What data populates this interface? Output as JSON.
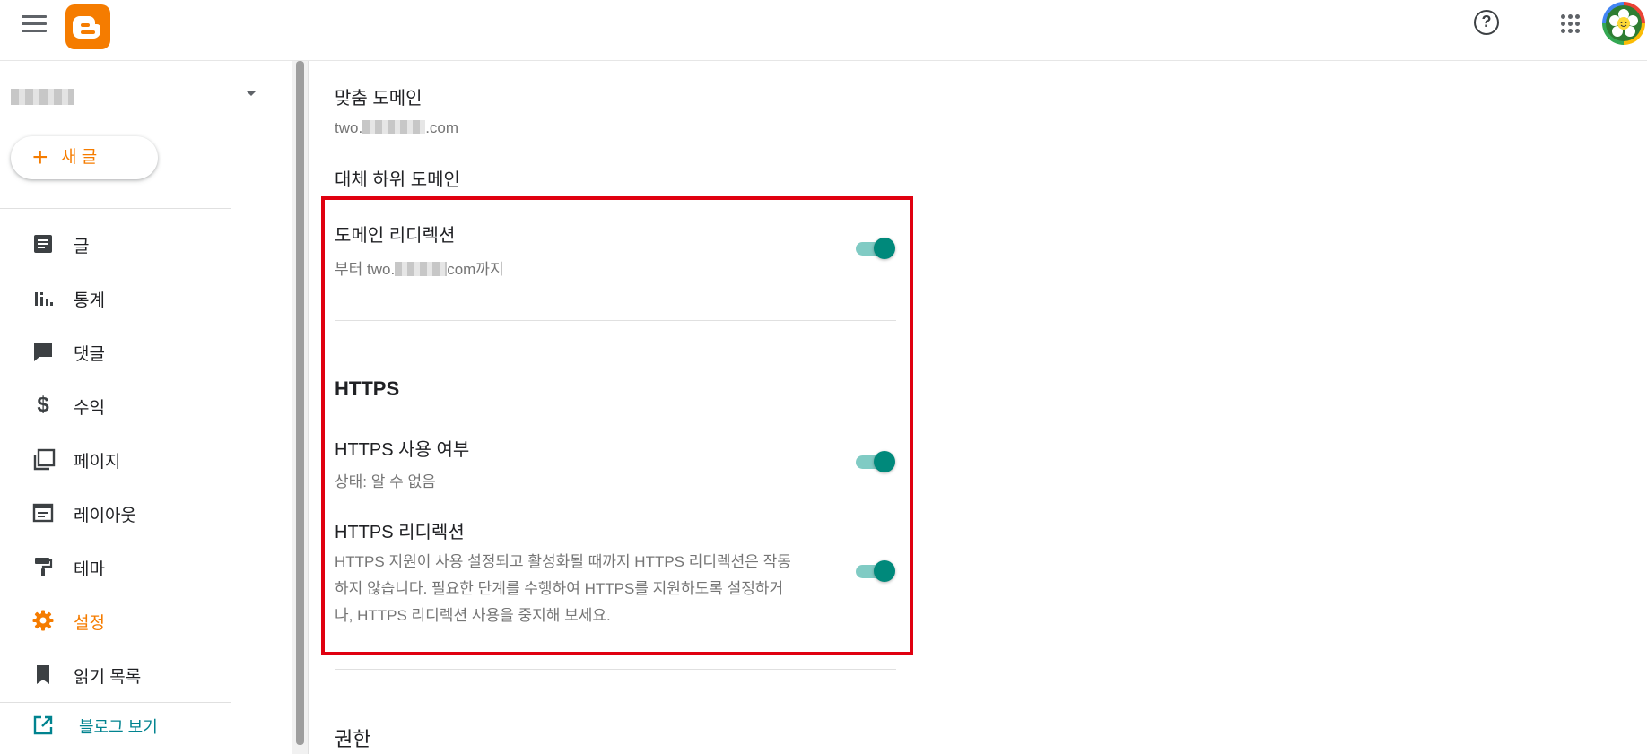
{
  "header": {
    "menu_icon": "hamburger-menu-icon",
    "logo_icon": "blogger-logo-icon",
    "help_icon": "help-circle-icon",
    "help_glyph": "?",
    "apps_icon": "apps-grid-icon",
    "avatar_icon": "user-avatar"
  },
  "sidebar": {
    "blog_selector_icon": "blog-dropdown-caret-icon",
    "new_post": {
      "plus": "+",
      "label": "새 글"
    },
    "items": [
      {
        "label": "글",
        "icon": "posts-icon"
      },
      {
        "label": "통계",
        "icon": "stats-icon"
      },
      {
        "label": "댓글",
        "icon": "comments-icon"
      },
      {
        "label": "수익",
        "icon": "earnings-dollar-icon"
      },
      {
        "label": "페이지",
        "icon": "pages-icon"
      },
      {
        "label": "레이아웃",
        "icon": "layout-icon"
      },
      {
        "label": "테마",
        "icon": "theme-paint-roller-icon"
      },
      {
        "label": "설정",
        "icon": "settings-gear-icon",
        "active": true
      },
      {
        "label": "읽기 목록",
        "icon": "reading-list-bookmark-icon"
      }
    ],
    "view_blog": {
      "label": "블로그 보기",
      "icon": "open-external-icon"
    }
  },
  "content": {
    "custom_domain": {
      "title": "맞춤 도메인",
      "value_prefix": "two.",
      "value_suffix": ".com"
    },
    "fallback_subdomain": {
      "title": "대체 하위 도메인"
    },
    "domain_redirect": {
      "title": "도메인 리디렉션",
      "sub_prefix": "부터 two.",
      "sub_suffix": "com까지",
      "enabled": true
    },
    "https": {
      "section_title": "HTTPS",
      "availability": {
        "title": "HTTPS 사용 여부",
        "status": "상태: 알 수 없음",
        "enabled": true
      },
      "redirect": {
        "title": "HTTPS 리디렉션",
        "desc_lines": [
          "HTTPS 지원이 사용 설정되고 활성화될 때까지 HTTPS 리디렉션은 작동",
          "하지 않습니다. 필요한 단계를 수행하여 HTTPS를 지원하도록 설정하거",
          "나, HTTPS 리디렉션 사용을 중지해 보세요."
        ],
        "enabled": true
      }
    },
    "permissions": {
      "title": "권한"
    }
  },
  "colors": {
    "accent_orange": "#f57c00",
    "toggle_on": "#00897b",
    "highlight_red": "#e00010",
    "link_teal": "#00838f"
  }
}
